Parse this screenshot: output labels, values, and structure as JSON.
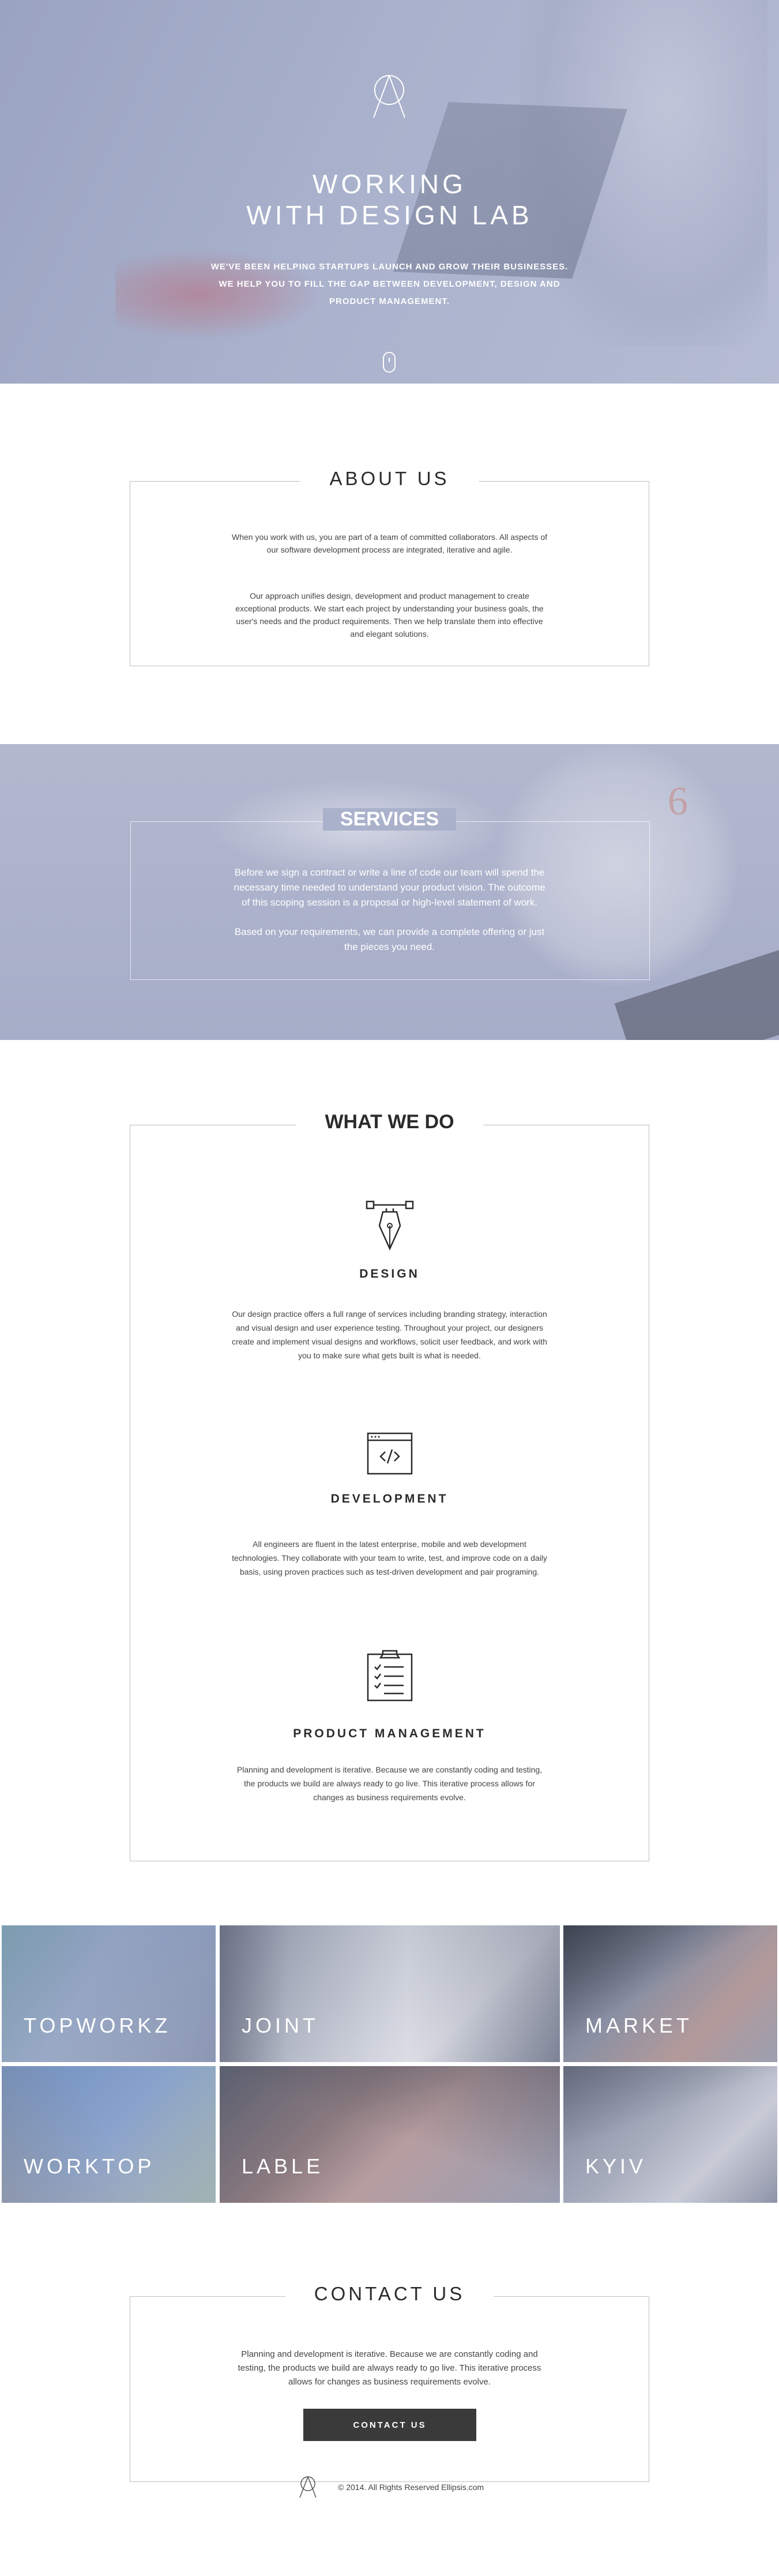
{
  "hero": {
    "title_line1": "WORKING",
    "title_line2": "WITH DESIGN LAB",
    "subtitle_line1": "WE'VE BEEN HELPING STARTUPS LAUNCH AND GROW THEIR BUSINESSES.",
    "subtitle_line2": "WE HELP YOU TO FILL THE GAP BETWEEN DEVELOPMENT, DESIGN AND",
    "subtitle_line3": "PRODUCT MANAGEMENT."
  },
  "about": {
    "title": "ABOUT US",
    "para1": "When you work with us, you are part of a team of committed collaborators. All aspects of our software development process are integrated, iterative and agile.",
    "para2": "Our approach unifies design, development and product management to create exceptional products. We start each project by understanding your business goals, the user's needs and the product requirements. Then we help translate them into effective and elegant solutions."
  },
  "services": {
    "title": "SERVICES",
    "para1": "Before we sign a contract or write a line of code our team will spend the necessary time needed to understand your product vision. The outcome of this scoping session is a proposal or high-level statement of work.",
    "para2": "Based on your requirements, we can provide a complete offering or just the pieces you need."
  },
  "what_we_do": {
    "title": "WHAT WE DO",
    "items": [
      {
        "icon": "pen-tool-icon",
        "name": "DESIGN",
        "desc": "Our design practice offers a full range of services including branding strategy, interaction and visual design and user experience testing. Throughout your project, our designers create and implement visual designs and workflows, solicit user feedback, and work with you to make sure what gets built is what is needed."
      },
      {
        "icon": "code-window-icon",
        "name": "DEVELOPMENT",
        "desc": "All engineers are fluent in the latest enterprise, mobile and web development technologies. They collaborate with your team to write, test, and improve code on a daily basis, using proven practices such as test-driven development and pair programing."
      },
      {
        "icon": "clipboard-checklist-icon",
        "name": "PRODUCT MANAGEMENT",
        "desc": "Planning and development is iterative. Because we are constantly coding and testing, the products we build are always ready to go live. This iterative process allows for changes as business requirements evolve."
      }
    ]
  },
  "portfolio": {
    "tiles": [
      {
        "label": "TOPWORKZ"
      },
      {
        "label": "JOINT"
      },
      {
        "label": "MARKET"
      },
      {
        "label": "WORKTOP"
      },
      {
        "label": "LABLE"
      },
      {
        "label": "KYIV"
      }
    ]
  },
  "contact": {
    "title": "CONTACT US",
    "text": "Planning and development is iterative. Because we are constantly coding and testing, the products we build are always ready to go live. This iterative process allows for changes as business requirements evolve.",
    "button_label": "CONTACT US"
  },
  "footer": {
    "copyright": "© 2014. All Rights Reserved Ellipsis.com"
  },
  "colors": {
    "hero_overlay": "#a9b1cc",
    "button_bg": "#3a3a3a",
    "frame_border": "#bfbfbf"
  }
}
